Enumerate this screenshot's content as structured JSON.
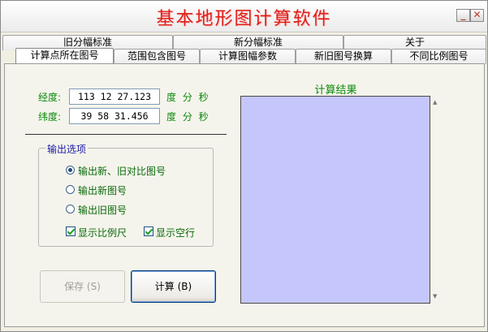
{
  "window": {
    "title": "基本地形图计算软件",
    "min_glyph": "_",
    "close_glyph": "✕"
  },
  "tabs_back": [
    "旧分幅标准",
    "新分幅标准",
    "关于"
  ],
  "tabs_front": [
    "计算点所在图号",
    "范围包含图号",
    "计算图幅参数",
    "新旧图号换算",
    "不同比例图号"
  ],
  "active_tab": "计算点所在图号",
  "longitude": {
    "label": "经度:",
    "value": "113 12 27.123",
    "unit": "度 分 秒"
  },
  "latitude": {
    "label": "纬度:",
    "value": "39 58 31.456",
    "unit": "度 分 秒"
  },
  "output_options": {
    "title": "输出选项",
    "radios": [
      "输出新、旧对比图号",
      "输出新图号",
      "输出旧图号"
    ],
    "selected": 0,
    "checkboxes": [
      {
        "label": "显示比例尺",
        "checked": true
      },
      {
        "label": "显示空行",
        "checked": true
      }
    ]
  },
  "buttons": {
    "save": "保存 (S)",
    "calc": "计算 (B)"
  },
  "result": {
    "title": "计算结果",
    "text": ""
  },
  "colors": {
    "title": "#e0201a",
    "label_green": "#0a8a0a",
    "group_title": "#1a1aa8",
    "result_bg": "#c5c7fc"
  }
}
